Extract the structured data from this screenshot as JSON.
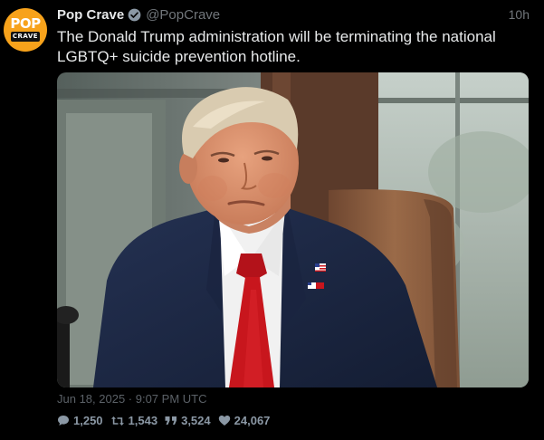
{
  "tweet": {
    "author": {
      "display_name": "Pop Crave",
      "handle": "@PopCrave",
      "avatar_top": "POP",
      "avatar_bottom": "CRAVE",
      "verified": true
    },
    "relative_time": "10h",
    "text": "The Donald Trump administration will be terminating the national LGBTQ+ suicide prevention hotline.",
    "date_line": "Jun 18, 2025 · 9:07 PM UTC",
    "stats": {
      "replies": "1,250",
      "retweets": "1,543",
      "quotes": "3,524",
      "likes": "24,067"
    },
    "media": {
      "kind": "photo"
    }
  },
  "colors": {
    "background": "#000000",
    "text_primary": "#e7e9ea",
    "text_secondary": "#71767b",
    "verified_badge": "#8b98a5",
    "avatar_brand": "#f7a21b",
    "suit": "#1c2740",
    "tie": "#c8161d",
    "chair": "#8a5a3a"
  },
  "icons": {
    "verified": "verified-badge-icon",
    "replies": "comment-icon",
    "retweets": "retweet-icon",
    "quotes": "quote-icon",
    "likes": "heart-icon"
  }
}
